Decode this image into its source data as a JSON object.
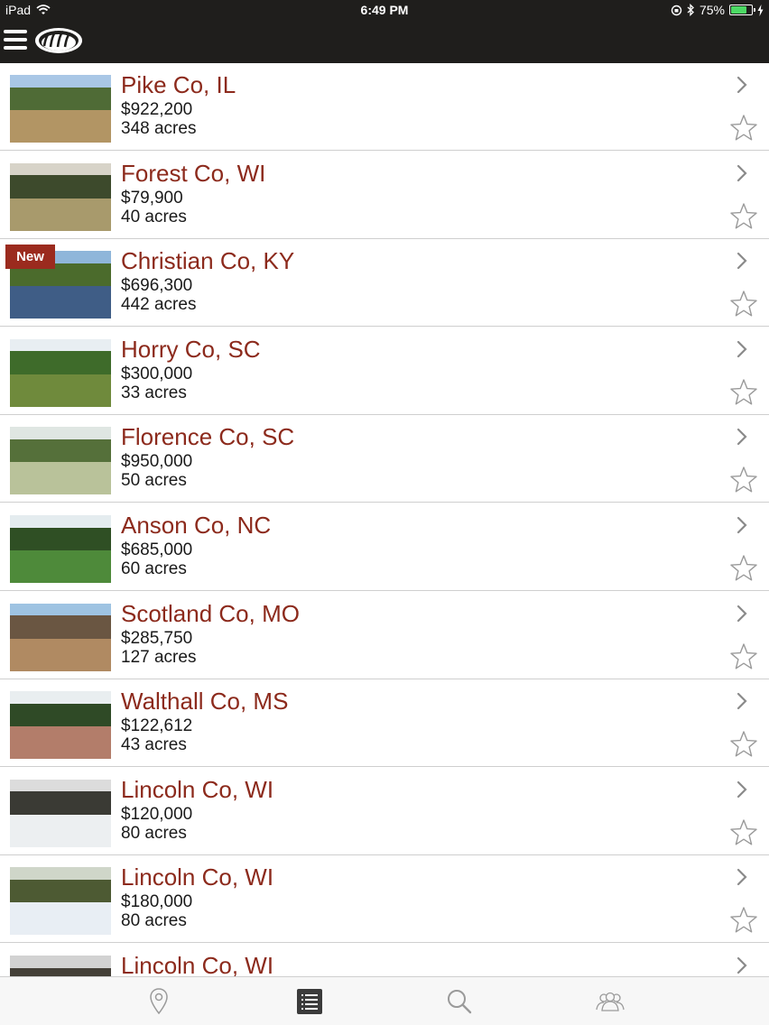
{
  "status_bar": {
    "device": "iPad",
    "time": "6:49 PM",
    "battery": "75%",
    "battery_level": 0.75
  },
  "nav": {
    "menu_icon": "hamburger-menu-icon",
    "logo": "paw-print-logo"
  },
  "listings": [
    {
      "title": "Pike Co, IL",
      "price": "$922,200",
      "acres": "348 acres",
      "badge": "",
      "favorite": false,
      "colors": [
        "#a9c7e6",
        "#4f6b36",
        "#b29564"
      ]
    },
    {
      "title": "Forest Co, WI",
      "price": "$79,900",
      "acres": "40 acres",
      "badge": "",
      "favorite": false,
      "colors": [
        "#d7d3c8",
        "#3d4a2c",
        "#a89a6c"
      ]
    },
    {
      "title": "Christian Co, KY",
      "price": "$696,300",
      "acres": "442 acres",
      "badge": "New",
      "favorite": false,
      "colors": [
        "#8fb6da",
        "#4b6b2c",
        "#3f5d86"
      ]
    },
    {
      "title": "Horry Co, SC",
      "price": "$300,000",
      "acres": "33 acres",
      "badge": "",
      "favorite": false,
      "colors": [
        "#e8eef2",
        "#3e6b2a",
        "#6f8a3c"
      ]
    },
    {
      "title": "Florence Co, SC",
      "price": "$950,000",
      "acres": "50 acres",
      "badge": "",
      "favorite": false,
      "colors": [
        "#dfe6e2",
        "#55703a",
        "#b9c29a"
      ]
    },
    {
      "title": "Anson Co, NC",
      "price": "$685,000",
      "acres": "60 acres",
      "badge": "",
      "favorite": false,
      "colors": [
        "#e4ecef",
        "#2f4f24",
        "#4e8a3a"
      ]
    },
    {
      "title": "Scotland Co, MO",
      "price": "$285,750",
      "acres": "127 acres",
      "badge": "",
      "favorite": false,
      "colors": [
        "#9ec3e2",
        "#6a5642",
        "#b08a62"
      ]
    },
    {
      "title": "Walthall Co, MS",
      "price": "$122,612",
      "acres": "43 acres",
      "badge": "",
      "favorite": false,
      "colors": [
        "#e9eef0",
        "#2f4a26",
        "#b37d6a"
      ]
    },
    {
      "title": "Lincoln Co, WI",
      "price": "$120,000",
      "acres": "80 acres",
      "badge": "",
      "favorite": false,
      "colors": [
        "#dcdcdc",
        "#3a3a34",
        "#eceff1"
      ]
    },
    {
      "title": "Lincoln Co, WI",
      "price": "$180,000",
      "acres": "80 acres",
      "badge": "",
      "favorite": false,
      "colors": [
        "#cfd6c9",
        "#4d5a33",
        "#e8eef4"
      ]
    },
    {
      "title": "Lincoln Co, WI",
      "price": "",
      "acres": "",
      "badge": "",
      "favorite": false,
      "colors": [
        "#d2d2d2",
        "#444038",
        "#e8ebee"
      ]
    }
  ],
  "tabbar": {
    "tabs": [
      {
        "icon": "map-pin-icon",
        "active": false
      },
      {
        "icon": "list-icon",
        "active": true
      },
      {
        "icon": "search-icon",
        "active": false
      },
      {
        "icon": "people-icon",
        "active": false
      }
    ]
  },
  "theme": {
    "title_color": "#8c2a1c",
    "bar_color": "#1f1e1c",
    "badge_color": "#9b2b1e"
  }
}
